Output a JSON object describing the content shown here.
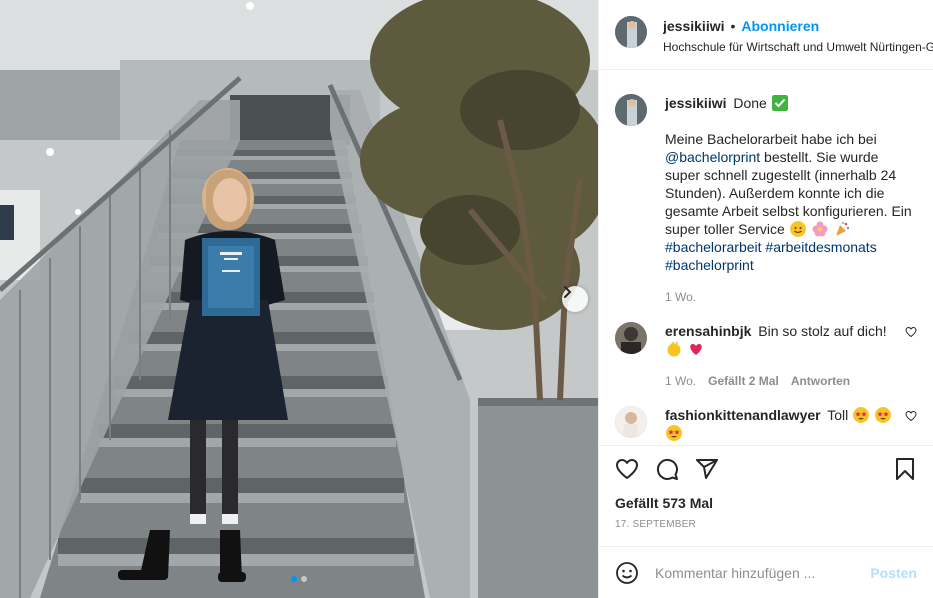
{
  "colors": {
    "link": "#00376b",
    "accent": "#0095f6",
    "muted": "#8e8e8e",
    "like_red": "#ed4956"
  },
  "header": {
    "username": "jessikiiwi",
    "separator": "•",
    "follow_label": "Abonnieren",
    "location": "Hochschule für Wirtschaft und Umwelt Nürtingen-G"
  },
  "caption": {
    "username": "jessikiiwi",
    "title": "Done",
    "title_emoji": "check-mark-icon",
    "text_1": "Meine Bachelorarbeit habe ich bei",
    "mention": "@bachelorprint",
    "text_2": "bestellt. Sie wurde super schnell zugestellt (innerhalb 24 Stunden). Außerdem konnte ich die gesamte Arbeit selbst konfigurieren. Ein super toller Service",
    "hashtag_1": "#bachelorarbeit",
    "hashtag_2": "#arbeitdesmonats",
    "hashtag_3": "#bachelorprint",
    "age": "1 Wo."
  },
  "comments": [
    {
      "username": "erensahinbjk",
      "text": "Bin so stolz auf dich!",
      "age": "1 Wo.",
      "likes": "Gefällt 2 Mal",
      "reply": "Antworten"
    },
    {
      "username": "fashionkittenandlawyer",
      "text": "Toll"
    }
  ],
  "actions": {
    "likes_label": "Gefällt 573 Mal",
    "date": "17. SEPTEMBER"
  },
  "add_comment": {
    "placeholder": "Kommentar hinzufügen ...",
    "post_label": "Posten"
  },
  "carousel": {
    "slide_count": 2,
    "current": 1
  }
}
